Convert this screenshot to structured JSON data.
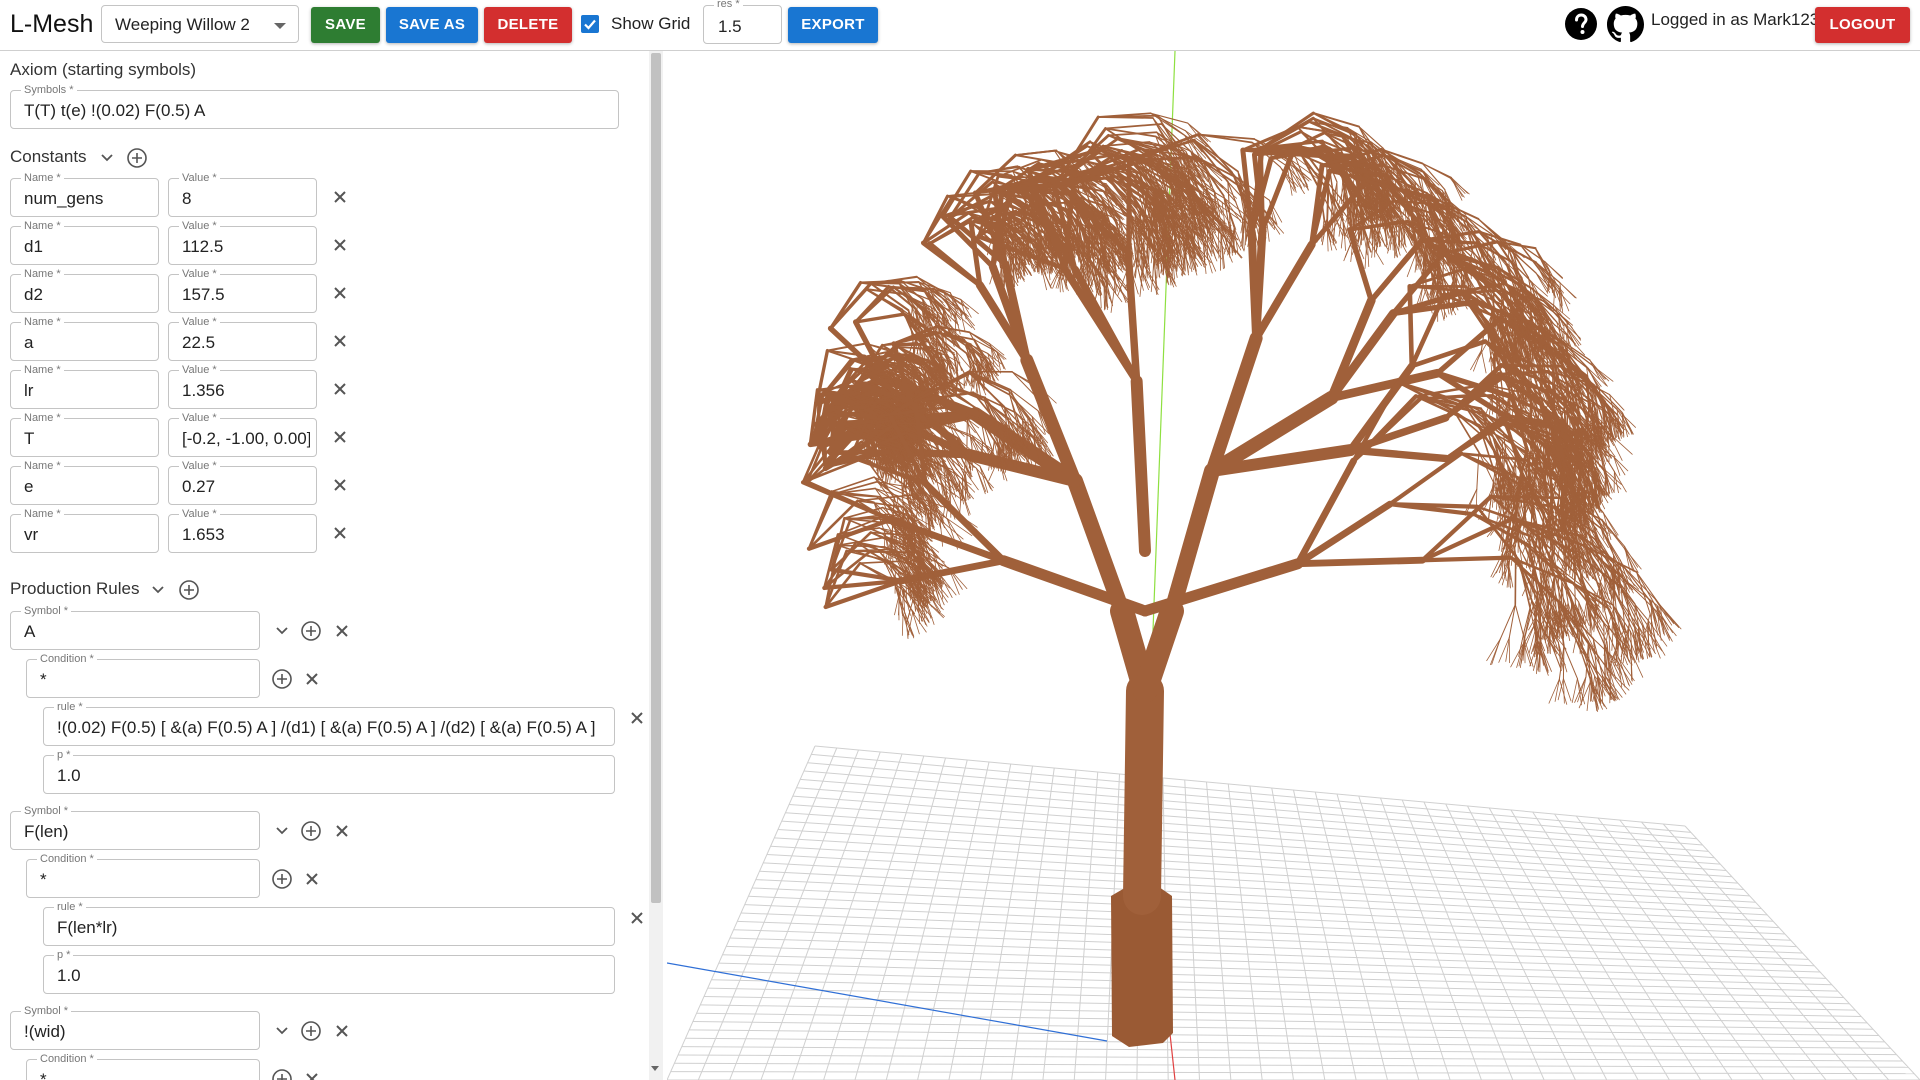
{
  "app": {
    "title": "L-Mesh"
  },
  "toolbar": {
    "preset": "Weeping Willow 2",
    "save_label": "SAVE",
    "save_as_label": "SAVE AS",
    "delete_label": "DELETE",
    "show_grid_label": "Show Grid",
    "show_grid_checked": true,
    "res_label": "res *",
    "res_value": "1.5",
    "export_label": "EXPORT",
    "logged_in_text": "Logged in as Mark123",
    "logout_label": "LOGOUT"
  },
  "axiom": {
    "title": "Axiom (starting symbols)",
    "symbols_label": "Symbols *",
    "symbols_value": "T(T) t(e) !(0.02) F(0.5) A"
  },
  "constants": {
    "title": "Constants",
    "name_label": "Name *",
    "value_label": "Value *",
    "items": [
      {
        "name": "num_gens",
        "value": "8"
      },
      {
        "name": "d1",
        "value": "112.5"
      },
      {
        "name": "d2",
        "value": "157.5"
      },
      {
        "name": "a",
        "value": "22.5"
      },
      {
        "name": "lr",
        "value": "1.356"
      },
      {
        "name": "T",
        "value": "[-0.2, -1.00, 0.00]"
      },
      {
        "name": "e",
        "value": "0.27"
      },
      {
        "name": "vr",
        "value": "1.653"
      }
    ]
  },
  "production": {
    "title": "Production Rules",
    "symbol_label": "Symbol *",
    "condition_label": "Condition *",
    "rule_label": "rule *",
    "p_label": "p *",
    "rules": [
      {
        "symbol": "A",
        "condition": "*",
        "rule": "!(0.02) F(0.5) [ &(a) F(0.5) A ] /(d1) [ &(a) F(0.5) A ] /(d2) [ &(a) F(0.5) A ]",
        "p": "1.0"
      },
      {
        "symbol": "F(len)",
        "condition": "*",
        "rule": "F(len*lr)",
        "p": "1.0"
      },
      {
        "symbol": "!(wid)",
        "condition": "*"
      }
    ]
  },
  "colors": {
    "save": "#2e7d32",
    "primary": "#1976d2",
    "danger": "#d32f2f",
    "bark": "#a0603a",
    "grid": "#d0d0d0"
  }
}
